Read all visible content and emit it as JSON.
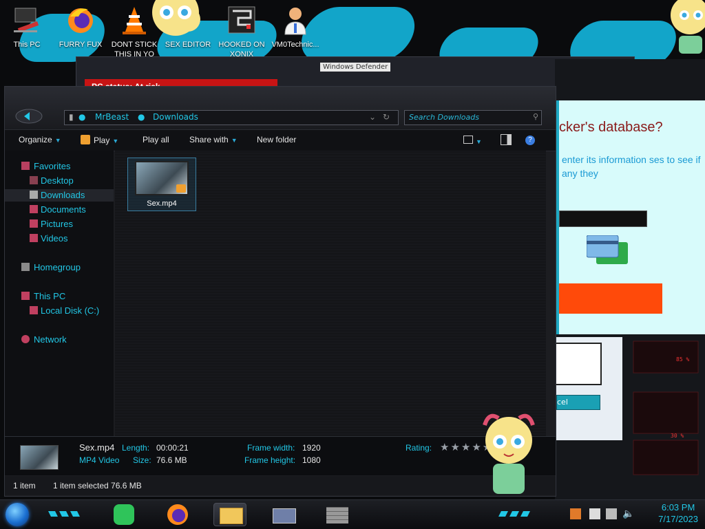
{
  "desktop": {
    "icons": [
      {
        "label": "This PC",
        "icon": "computer-icon"
      },
      {
        "label": "FURRY FUX",
        "icon": "firefox-icon"
      },
      {
        "label": "DONT STICK THIS IN YO",
        "icon": "vlc-cone-icon"
      },
      {
        "label": "SEX EDITOR",
        "icon": "cartoon-icon"
      },
      {
        "label": "HOOKED ON XONIX",
        "icon": "maze-icon"
      },
      {
        "label": "VM0Technic...",
        "icon": "doctor-icon"
      }
    ]
  },
  "background_window": {
    "title": "Windows Defender",
    "status": "PC status: At risk"
  },
  "popup": {
    "heading": "cker's database?",
    "subtext": "enter its information ses to see if any they",
    "cancel_label": "cel"
  },
  "explorer": {
    "breadcrumb": [
      "MrBeast",
      "Downloads"
    ],
    "search_placeholder": "Search Downloads",
    "toolbar": {
      "organize": "Organize",
      "play": "Play",
      "play_all": "Play all",
      "share_with": "Share with",
      "new_folder": "New folder"
    },
    "nav": {
      "favorites": "Favorites",
      "desktop": "Desktop",
      "downloads": "Downloads",
      "documents": "Documents",
      "pictures": "Pictures",
      "videos": "Videos",
      "homegroup": "Homegroup",
      "this_pc": "This PC",
      "local_disk": "Local Disk (C:)",
      "network": "Network"
    },
    "selected_nav": "Downloads",
    "files": [
      {
        "name": "Sex.mp4"
      }
    ],
    "details": {
      "name": "Sex.mp4",
      "type": "MP4 Video",
      "length_label": "Length:",
      "length": "00:00:21",
      "size_label": "Size:",
      "size": "76.6 MB",
      "frame_width_label": "Frame width:",
      "frame_width": "1920",
      "frame_height_label": "Frame height:",
      "frame_height": "1080",
      "rating_label": "Rating:",
      "rating_stars": 0
    },
    "status": {
      "count": "1 item",
      "selection": "1 item selected  76.6 MB"
    }
  },
  "taskbar": {
    "time": "6:03 PM",
    "date": "7/17/2023",
    "apps": [
      "notes-app-icon",
      "firefox-icon",
      "file-explorer-icon",
      "id-card-icon",
      "brick-wall-icon"
    ]
  },
  "colors": {
    "accent": "#22c7e6",
    "danger": "#c81414",
    "popup_bg": "#d8fbfb",
    "orange": "#ff4a0a"
  }
}
